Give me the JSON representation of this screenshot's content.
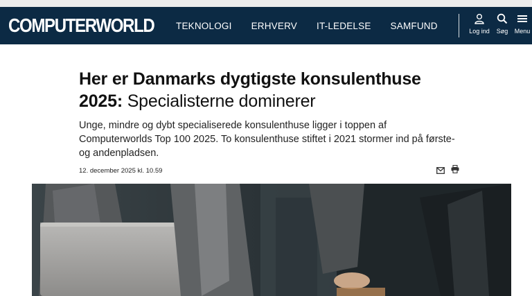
{
  "brand": {
    "name": "COMPUTERWORLD",
    "nav_bg": "#0c2a44"
  },
  "nav": {
    "links": [
      "TEKNOLOGI",
      "ERHVERV",
      "IT-LEDELSE",
      "SAMFUND"
    ],
    "actions": {
      "login": {
        "label": "Log ind",
        "icon": "user-icon"
      },
      "search": {
        "label": "Søg",
        "icon": "search-icon"
      },
      "menu": {
        "label": "Menu",
        "icon": "hamburger-icon"
      }
    }
  },
  "article": {
    "headline_bold": "Her er Danmarks dygtigste konsulenthuse 2025:",
    "headline_rest": " Specialisterne dominerer",
    "lead": "Unge, mindre og dybt specialiserede konsulenthuse ligger i toppen af Computerworlds Top 100 2025. To konsulenthuse stiftet i 2021 stormer ind på første- og andenpladsen.",
    "date": "12. december 2025 kl. 10.59",
    "share_icons": [
      "mail-icon",
      "print-icon"
    ]
  },
  "hero": {
    "icon": "photo-business-meeting"
  }
}
